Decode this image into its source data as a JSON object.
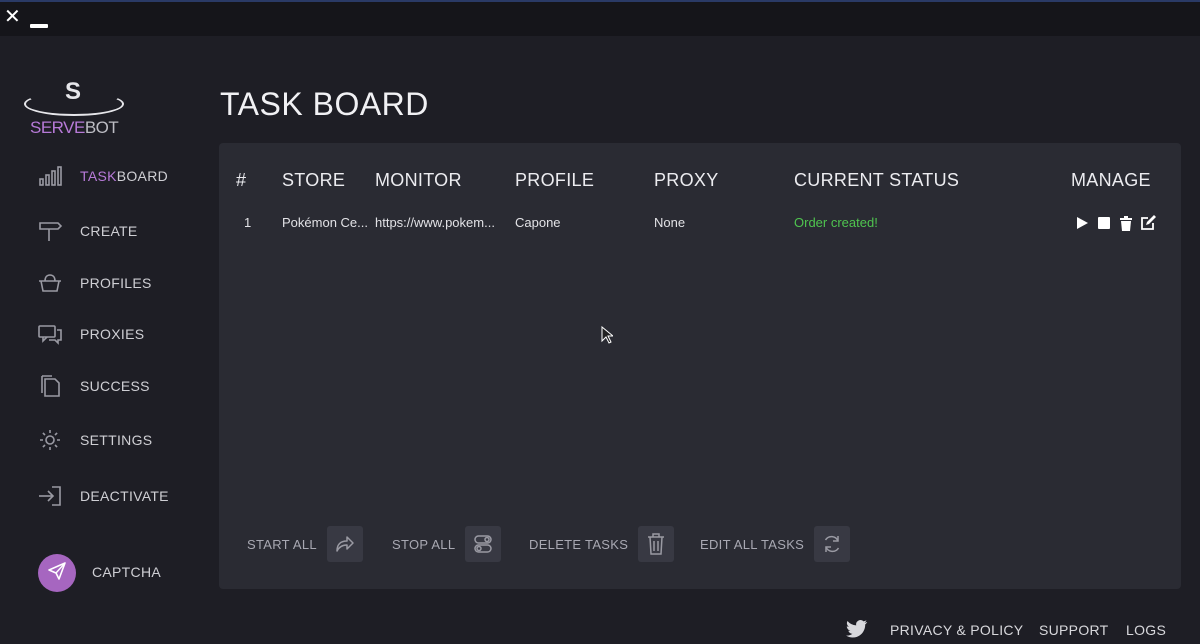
{
  "window": {
    "close_symbol": "✕"
  },
  "brand": {
    "logo_letter": "S",
    "name_part1": "SERVE",
    "name_part2": "BOT",
    "accent_color": "#b77ad8"
  },
  "sidebar": {
    "items": [
      {
        "label_hl": "TASK",
        "label_rest": "BOARD",
        "icon": "bar-chart-icon",
        "active": true
      },
      {
        "label": "CREATE",
        "icon": "signpost-icon"
      },
      {
        "label": "PROFILES",
        "icon": "basket-icon"
      },
      {
        "label": "PROXIES",
        "icon": "chat-bubbles-icon"
      },
      {
        "label": "SUCCESS",
        "icon": "documents-icon"
      },
      {
        "label": "SETTINGS",
        "icon": "gear-icon"
      },
      {
        "label": "DEACTIVATE",
        "icon": "sign-in-icon"
      }
    ],
    "captcha": {
      "label": "CAPTCHA",
      "icon": "paper-plane-icon"
    }
  },
  "main": {
    "title": "TASK BOARD"
  },
  "table": {
    "columns": [
      "#",
      "STORE",
      "MONITOR",
      "PROFILE",
      "PROXY",
      "CURRENT STATUS",
      "MANAGE"
    ],
    "rows": [
      {
        "num": "1",
        "store": "Pokémon Ce...",
        "monitor": "https://www.pokem...",
        "profile": "Capone",
        "proxy": "None",
        "status": "Order created!",
        "status_color": "#4fc44f"
      }
    ],
    "row_actions": [
      "play-icon",
      "stop-icon",
      "trash-icon",
      "edit-icon"
    ]
  },
  "footer_actions": [
    {
      "label": "START ALL",
      "icon": "share-arrow-icon"
    },
    {
      "label": "STOP ALL",
      "icon": "toggles-icon"
    },
    {
      "label": "DELETE TASKS",
      "icon": "trash-icon"
    },
    {
      "label": "EDIT ALL TASKS",
      "icon": "refresh-icon"
    }
  ],
  "bottom_links": [
    "PRIVACY & POLICY",
    "SUPPORT",
    "LOGS"
  ],
  "social": {
    "icon": "twitter-icon"
  }
}
